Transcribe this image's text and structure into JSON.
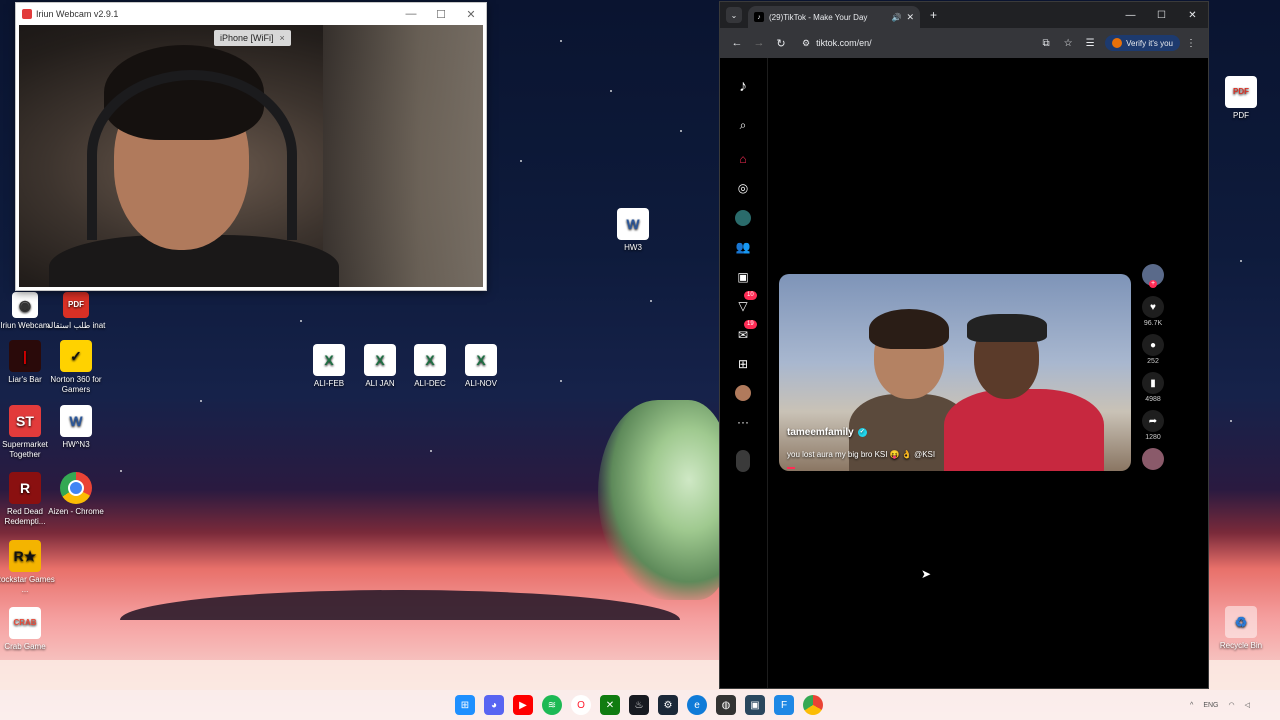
{
  "webcam": {
    "title": "Iriun Webcam v2.9.1",
    "device_badge": "iPhone [WiFi]",
    "controls": [
      "—",
      "☐",
      "✕"
    ]
  },
  "desktop": {
    "left_icons": [
      {
        "label": "Iriun Webcam",
        "icon": "webcam-icon",
        "color": "#ffffff"
      },
      {
        "label": "طلب استقالة inat",
        "icon": "pdf-icon",
        "color": "#d93025"
      },
      {
        "label": "Liar's Bar",
        "icon": "liars-bar-icon",
        "color": "#8b0000"
      },
      {
        "label": "Norton 360 for Gamers",
        "icon": "norton-icon",
        "color": "#ffd200"
      },
      {
        "label": "Supermarket Together",
        "icon": "supermarket-icon",
        "color": "#e23b3b"
      },
      {
        "label": "HW^N3",
        "icon": "word-doc-icon",
        "color": "#2b579a"
      },
      {
        "label": "Red Dead Redempti...",
        "icon": "red-dead-icon",
        "color": "#8a1010"
      },
      {
        "label": "Aizen - Chrome",
        "icon": "chrome-icon",
        "color": "#4285f4"
      },
      {
        "label": "Rockstar Games ...",
        "icon": "rockstar-icon",
        "color": "#f4b400"
      },
      {
        "label": "Crab Game",
        "icon": "crab-game-icon",
        "color": "#e74c3c"
      }
    ],
    "middle_icons": [
      {
        "label": "HW3",
        "icon": "word-doc-icon"
      },
      {
        "label": "ALI-FEB",
        "icon": "excel-icon"
      },
      {
        "label": "ALI JAN",
        "icon": "excel-icon"
      },
      {
        "label": "ALI-DEC",
        "icon": "excel-icon"
      },
      {
        "label": "ALI-NOV",
        "icon": "excel-icon"
      }
    ],
    "right_icons": [
      {
        "label": "PDF",
        "icon": "pdf-icon"
      },
      {
        "label": "Recycle Bin",
        "icon": "recycle-bin-icon"
      }
    ]
  },
  "browser": {
    "tab_title": "(29)TikTok - Make Your Day",
    "url": "tiktok.com/en/",
    "verify_label": "Verify it's you",
    "win_controls": [
      "—",
      "☐",
      "✕"
    ]
  },
  "tiktok": {
    "sidebar_badges": {
      "activity": "10",
      "messages": "19"
    },
    "video": {
      "username": "tameemfamily",
      "caption": "you lost aura my big bro KSI 😝 👌 @KSI"
    },
    "actions": {
      "likes": "96.7K",
      "comments": "252",
      "saves": "4988",
      "shares": "1280"
    }
  },
  "taskbar": {
    "language": "ENG",
    "icons": [
      "windows-start-icon",
      "discord-icon",
      "youtube-icon",
      "spotify-icon",
      "opera-icon",
      "xbox-icon",
      "steam-icon-1",
      "steam-icon-2",
      "edge-icon",
      "epic-icon",
      "steam-icon-3",
      "file-explorer-icon",
      "chrome-icon"
    ]
  },
  "colors": {
    "tiktok_red": "#fe2c55",
    "verified": "#20d5ec",
    "chrome_dark": "#202124"
  }
}
